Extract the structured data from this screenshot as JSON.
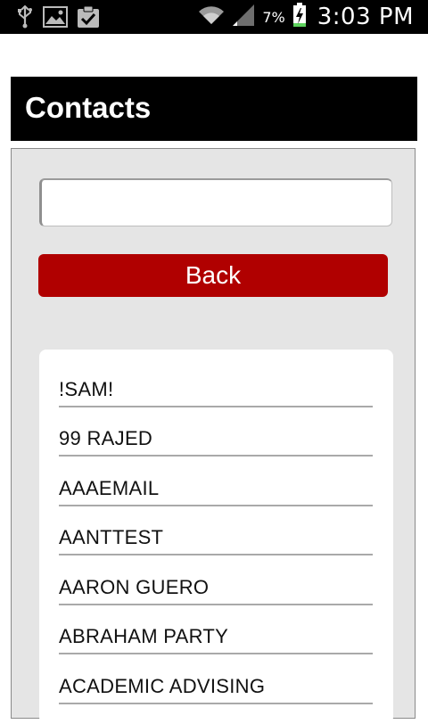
{
  "status_bar": {
    "battery_percent": "7%",
    "time": "3:03 PM",
    "icons": [
      "usb-icon",
      "image-icon",
      "clipboard-check-icon",
      "wifi-icon",
      "signal-icon",
      "battery-charging-icon"
    ]
  },
  "header": {
    "title": "Contacts"
  },
  "search": {
    "value": "",
    "placeholder": ""
  },
  "buttons": {
    "back_label": "Back"
  },
  "contacts": [
    {
      "name": "!SAM!"
    },
    {
      "name": "99 RAJED"
    },
    {
      "name": "AAAEMAIL"
    },
    {
      "name": "AANTTEST"
    },
    {
      "name": "AARON GUERO"
    },
    {
      "name": "ABRAHAM PARTY"
    },
    {
      "name": "ACADEMIC ADVISING"
    }
  ],
  "colors": {
    "accent_red": "#b00000",
    "panel_gray": "#e5e5e5",
    "header_black": "#000000"
  }
}
